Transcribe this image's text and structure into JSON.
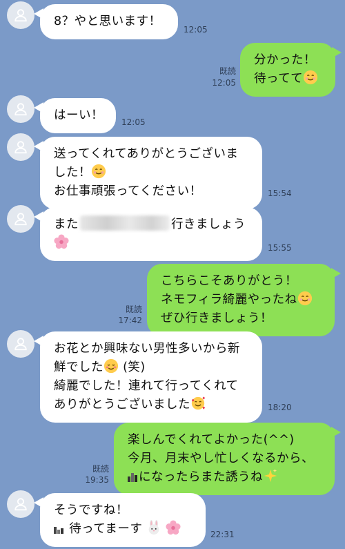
{
  "messages": [
    {
      "text": [
        "8？やと思います！"
      ],
      "time": "12:05"
    },
    {
      "text": [
        "分かった！",
        "待ってて"
      ],
      "read": "既読",
      "time": "12:05"
    },
    {
      "text": [
        "はーい！"
      ],
      "time": "12:05"
    },
    {
      "text": [
        "送ってくれてありがとうございま",
        "した！",
        "お仕事頑張ってください！"
      ],
      "time": "15:54"
    },
    {
      "text": [
        "また",
        "行きましょう"
      ],
      "time": "15:55"
    },
    {
      "text": [
        "こちらこそありがとう！",
        "ネモフィラ綺麗やったね",
        "ぜひ行きましょう！"
      ],
      "read": "既読",
      "time": "17:42"
    },
    {
      "text": [
        "お花とか興味ない男性多いから新",
        "鮮でした",
        "(笑)",
        "綺麗でした！連れて行ってくれて",
        "ありがとうございました"
      ],
      "time": "18:20"
    },
    {
      "text": [
        "楽しんでくれてよかった(^^)",
        "今月、月末やし忙しくなるから、",
        "になったらまた誘うね"
      ],
      "read": "既読",
      "time": "19:35"
    },
    {
      "text": [
        "そうですね！",
        "待ってまーす"
      ],
      "time": "22:31"
    }
  ],
  "colors": {
    "background": "#7b9ac8",
    "incoming_bubble": "#ffffff",
    "outgoing_bubble": "#8de055"
  },
  "icons": {
    "avatar": "person-silhouette-icon",
    "smile": "smiling-face-emoji",
    "blush": "blushing-face-emoji",
    "hearts": "smiling-face-with-hearts-emoji",
    "flower": "cherry-blossom-emoji",
    "rabbit": "rabbit-face-emoji",
    "sparkles": "sparkles-emoji"
  }
}
